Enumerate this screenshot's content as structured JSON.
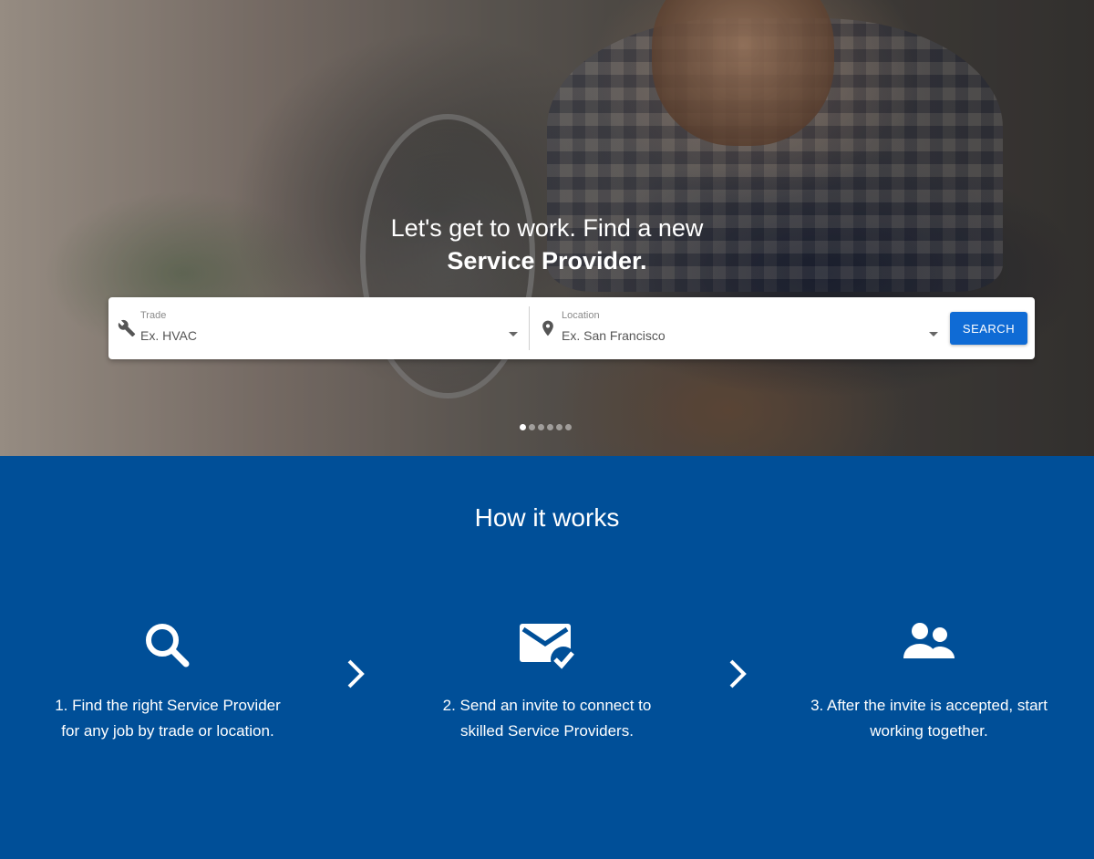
{
  "hero": {
    "title_line1": "Let's get to work.  Find a new",
    "title_line2": "Service Provider.",
    "carousel_dots": 6,
    "carousel_active": 0
  },
  "search": {
    "trade": {
      "label": "Trade",
      "placeholder": "Ex. HVAC",
      "icon": "wrench-icon"
    },
    "location": {
      "label": "Location",
      "placeholder": "Ex. San Francisco",
      "icon": "map-pin-icon"
    },
    "button_label": "SEARCH"
  },
  "how_it_works": {
    "title": "How it works",
    "steps": [
      {
        "icon": "search-icon",
        "line1": "1. Find the right Service Provider",
        "line2": "for any job by trade or location."
      },
      {
        "icon": "mail-check-icon",
        "line1": "2. Send an invite to connect to",
        "line2": "skilled Service Providers."
      },
      {
        "icon": "people-icon",
        "line1": "3. After the invite is accepted, start",
        "line2": "working together."
      }
    ]
  },
  "colors": {
    "section_bg": "#004f98",
    "button_bg": "#0f6bd5",
    "text_on_dark": "#ffffff"
  }
}
